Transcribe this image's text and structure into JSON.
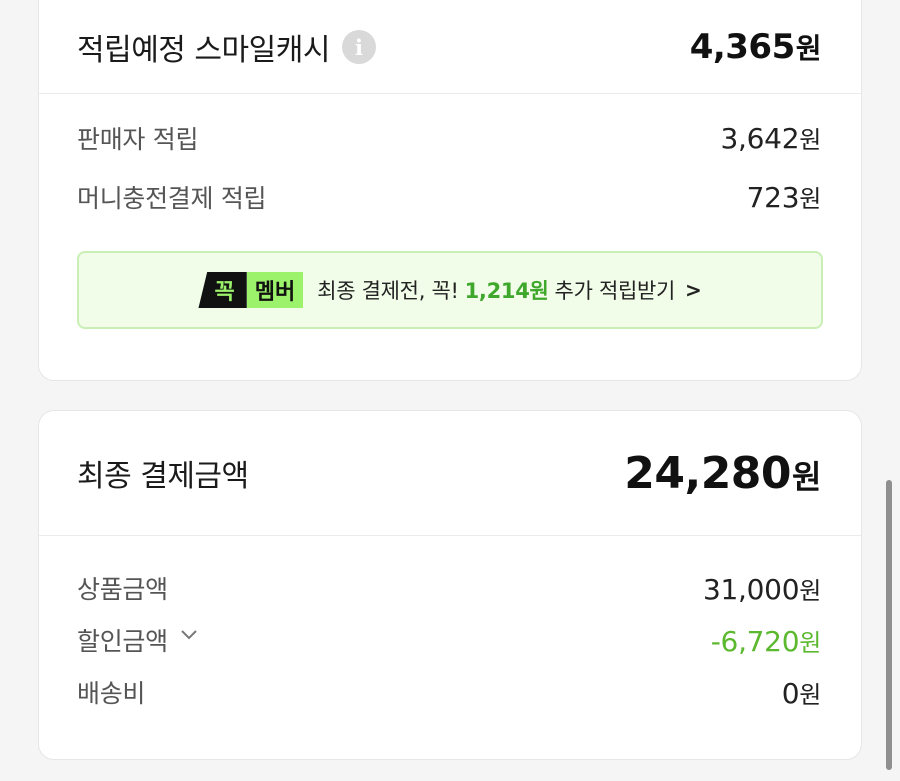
{
  "earn_card": {
    "title": "적립예정 스마일캐시",
    "info_icon": "i",
    "total_amount": "4,365",
    "total_unit": "원",
    "rows": [
      {
        "label": "판매자 적립",
        "amount": "3,642",
        "unit": "원"
      },
      {
        "label": "머니충전결제 적립",
        "amount": "723",
        "unit": "원"
      }
    ],
    "promo": {
      "badge_black": "꼭",
      "badge_green": "멤버",
      "text_before": "최종 결제전, 꼭!",
      "amount": "1,214원",
      "text_after": "추가 적립받기",
      "arrow": ">"
    }
  },
  "payment_card": {
    "title": "최종 결제금액",
    "total_amount": "24,280",
    "total_unit": "원",
    "rows": [
      {
        "label": "상품금액",
        "amount": "31,000",
        "unit": "원"
      },
      {
        "label": "할인금액",
        "amount": "-6,720",
        "unit": "원"
      },
      {
        "label": "배송비",
        "amount": "0",
        "unit": "원"
      }
    ]
  },
  "colors": {
    "accent_green": "#5cb82f",
    "badge_green": "#9cf26a",
    "promo_bg": "#f1fde8"
  }
}
